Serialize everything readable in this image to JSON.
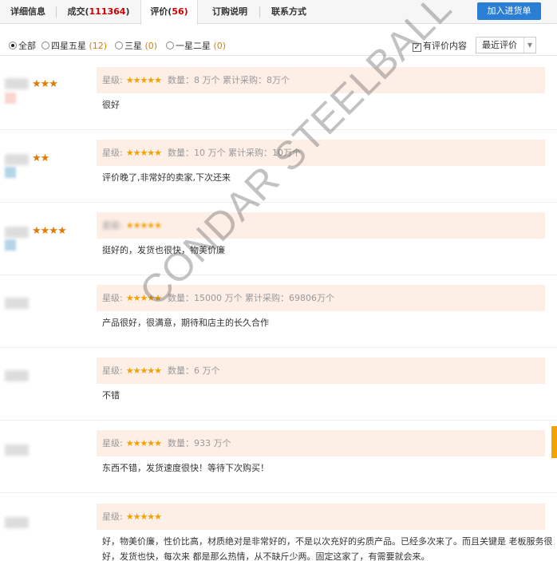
{
  "tabs": [
    {
      "label": "详细信息",
      "count": ""
    },
    {
      "label": "成交(",
      "count": "111364",
      "close": ")"
    },
    {
      "label": "评价(",
      "count": "56",
      "close": ")"
    },
    {
      "label": "订购说明",
      "count": ""
    },
    {
      "label": "联系方式",
      "count": ""
    }
  ],
  "cart_button": "加入进货单",
  "filters": [
    {
      "label": "全部",
      "count": "",
      "selected": true
    },
    {
      "label": "四星五星 ",
      "count": "(12)",
      "selected": false
    },
    {
      "label": "三星 ",
      "count": "(0)",
      "selected": false
    },
    {
      "label": "一星二星 ",
      "count": "(0)",
      "selected": false
    }
  ],
  "has_content_checkbox": {
    "label": "有评价内容",
    "checked": "✓"
  },
  "sort": {
    "value": "最近评价",
    "arrow": "▼"
  },
  "star_label": "星级:",
  "stars": "★★★★★",
  "reviews": [
    {
      "medals": "★★★",
      "meta": "数量：8 万个    累计采购：8万个",
      "text": "很好"
    },
    {
      "medals": "★★",
      "meta": "数量：10 万个    累计采购：10万个",
      "text": "评价晚了,非常好的卖家,下次还来"
    },
    {
      "medals": "★★★★",
      "meta": "",
      "text": "挺好的，发货也很快，物美价廉"
    },
    {
      "medals": "",
      "meta": "数量：15000 万个    累计采购：69806万个",
      "text": "产品很好，很满意，期待和店主的长久合作"
    },
    {
      "medals": "",
      "meta": "数量：6 万个",
      "text": "不错"
    },
    {
      "medals": "",
      "meta": "数量：933 万个",
      "text": "东西不错，发货速度很快！等待下次购买！"
    },
    {
      "medals": "",
      "meta": "",
      "text": "好，物美价廉，性价比高，材质绝对是非常好的，不是以次充好的劣质产品。已经多次来了。而且关键是 老板服务很好，发货也快，每次来 都是那么热情，从不缺斤少两。固定这家了，有需要就会来。"
    }
  ],
  "watermark": "CONDAR STEELBALL",
  "colors": {
    "accent": "#2a7fd4",
    "count": "#c00000",
    "star": "#f5a100",
    "info_bg": "#fdeee6"
  }
}
